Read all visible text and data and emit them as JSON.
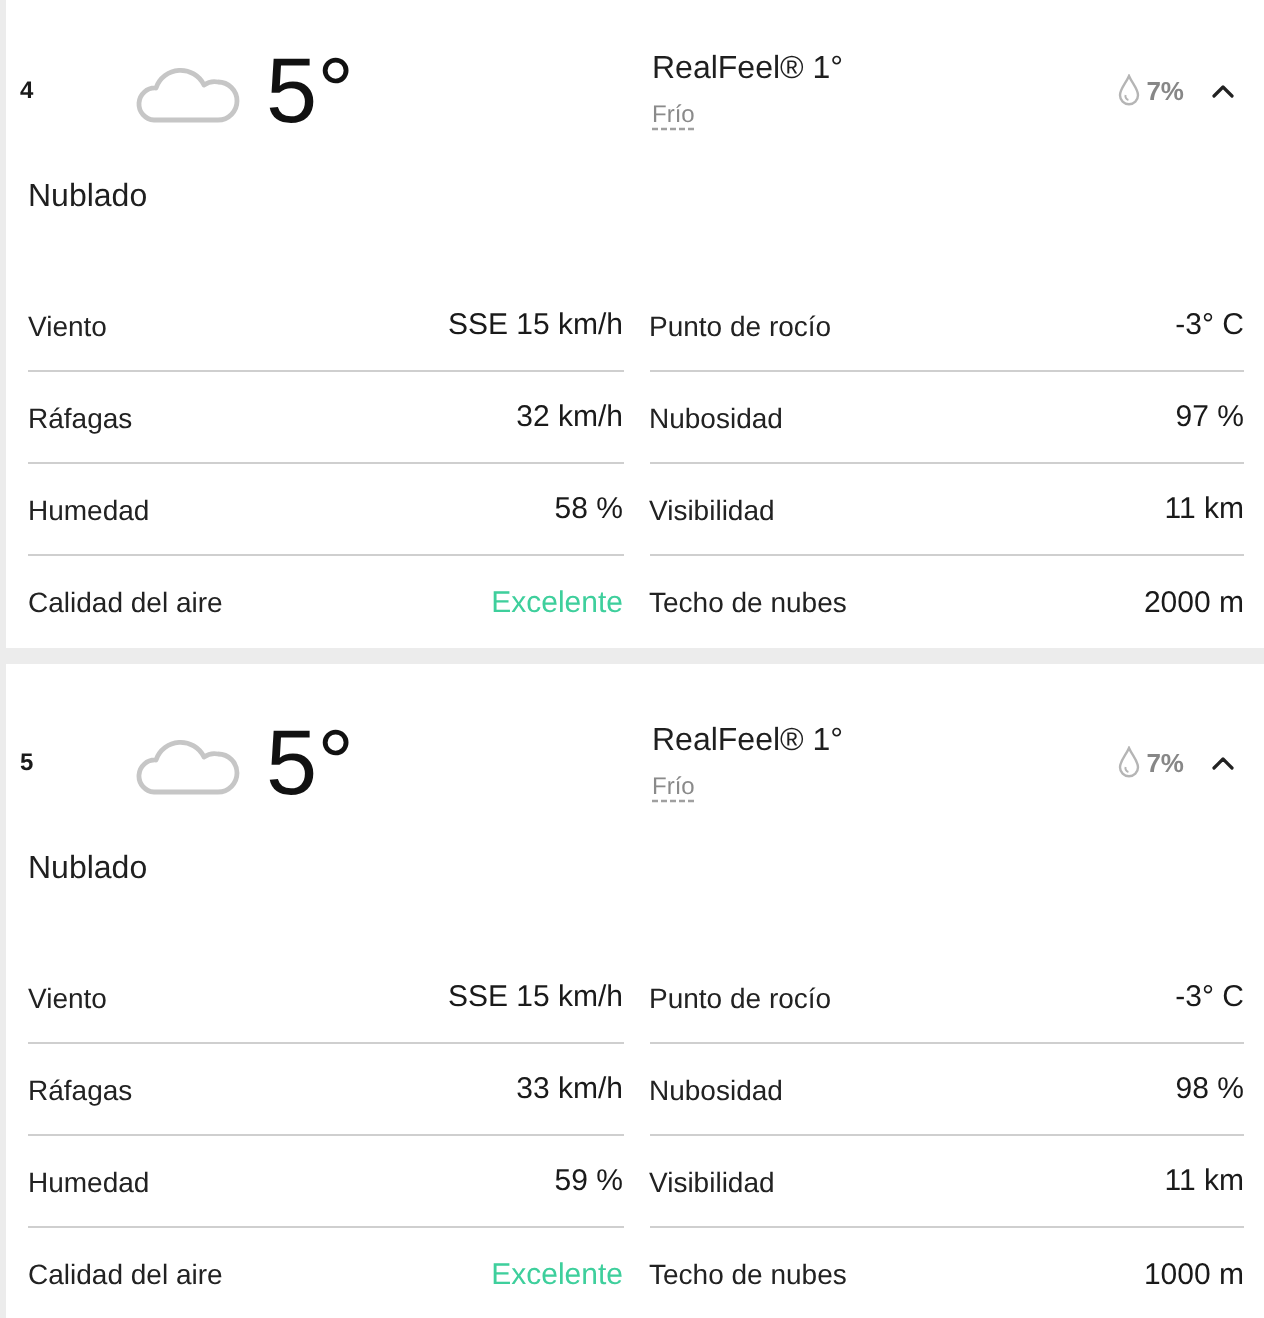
{
  "hours": [
    {
      "hour": "4",
      "temperature": "5°",
      "realfeel": "RealFeel® 1°",
      "realfeel_phrase": "Frío",
      "precipitation": "7%",
      "expanded": true,
      "condition": "Nublado",
      "details": [
        {
          "label": "Viento",
          "value": "SSE 15 km/h"
        },
        {
          "label": "Ráfagas",
          "value": "32 km/h"
        },
        {
          "label": "Humedad",
          "value": "58 %"
        },
        {
          "label": "Calidad del aire",
          "value": "Excelente",
          "color": "#3ecf9c"
        },
        {
          "label": "Punto de rocío",
          "value": "-3° C"
        },
        {
          "label": "Nubosidad",
          "value": "97 %"
        },
        {
          "label": "Visibilidad",
          "value": "11 km"
        },
        {
          "label": "Techo de nubes",
          "value": "2000 m"
        }
      ]
    },
    {
      "hour": "5",
      "temperature": "5°",
      "realfeel": "RealFeel® 1°",
      "realfeel_phrase": "Frío",
      "precipitation": "7%",
      "expanded": true,
      "condition": "Nublado",
      "details": [
        {
          "label": "Viento",
          "value": "SSE 15 km/h"
        },
        {
          "label": "Ráfagas",
          "value": "33 km/h"
        },
        {
          "label": "Humedad",
          "value": "59 %"
        },
        {
          "label": "Calidad del aire",
          "value": "Excelente",
          "color": "#3ecf9c"
        },
        {
          "label": "Punto de rocío",
          "value": "-3° C"
        },
        {
          "label": "Nubosidad",
          "value": "98 %"
        },
        {
          "label": "Visibilidad",
          "value": "11 km"
        },
        {
          "label": "Techo de nubes",
          "value": "1000 m"
        }
      ]
    }
  ]
}
